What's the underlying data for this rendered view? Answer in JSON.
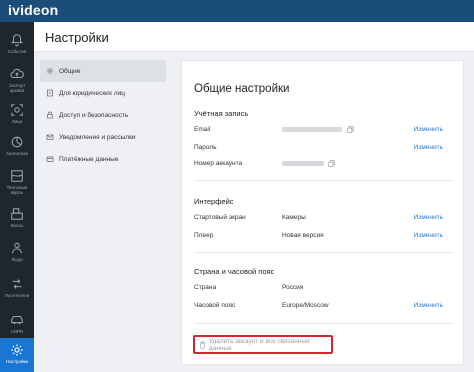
{
  "app": {
    "logo": "ivideon"
  },
  "sidebar": {
    "items": [
      {
        "label": "События",
        "icon": "bell-icon"
      },
      {
        "label": "Экспорт архива",
        "icon": "cloud-upload-icon"
      },
      {
        "label": "Лица",
        "icon": "face-icon"
      },
      {
        "label": "Аналитика",
        "icon": "analytics-icon"
      },
      {
        "label": "Тепловые карты",
        "icon": "heatmap-icon"
      },
      {
        "label": "Кассы",
        "icon": "cash-register-icon"
      },
      {
        "label": "Люди",
        "icon": "people-icon"
      },
      {
        "label": "Посетители",
        "icon": "visitors-icon"
      },
      {
        "label": "ANPR",
        "icon": "car-icon"
      },
      {
        "label": "Настройки",
        "icon": "gear-icon"
      }
    ]
  },
  "header": {
    "title": "Настройки"
  },
  "menu": {
    "items": [
      {
        "label": "Общие",
        "icon": "gear-icon"
      },
      {
        "label": "Для юридических лиц",
        "icon": "document-icon"
      },
      {
        "label": "Доступ и безопасность",
        "icon": "lock-icon"
      },
      {
        "label": "Уведомления и рассылки",
        "icon": "mail-icon"
      },
      {
        "label": "Платёжные данные",
        "icon": "card-icon"
      }
    ]
  },
  "main": {
    "title": "Общие настройки",
    "account": {
      "title": "Учётная запись",
      "email_label": "Email",
      "password_label": "Пароль",
      "account_number_label": "Номер аккаунта"
    },
    "interface": {
      "title": "Интерфейс",
      "start_screen_label": "Стартовый экран",
      "start_screen_value": "Камеры",
      "player_label": "Плеер",
      "player_value": "Новая версия"
    },
    "region": {
      "title": "Страна и часовой пояс",
      "country_label": "Страна",
      "country_value": "Россия",
      "timezone_label": "Часовой пояс",
      "timezone_value": "Europe/Moscow"
    },
    "change_label": "Изменить",
    "delete_label": "Удалить аккаунт и все связанные данные"
  },
  "colors": {
    "topbar": "#1a4d7a",
    "sidebar": "#20262e",
    "accent": "#1976d2",
    "link": "#2a7ad2",
    "highlight": "#d9262b"
  }
}
